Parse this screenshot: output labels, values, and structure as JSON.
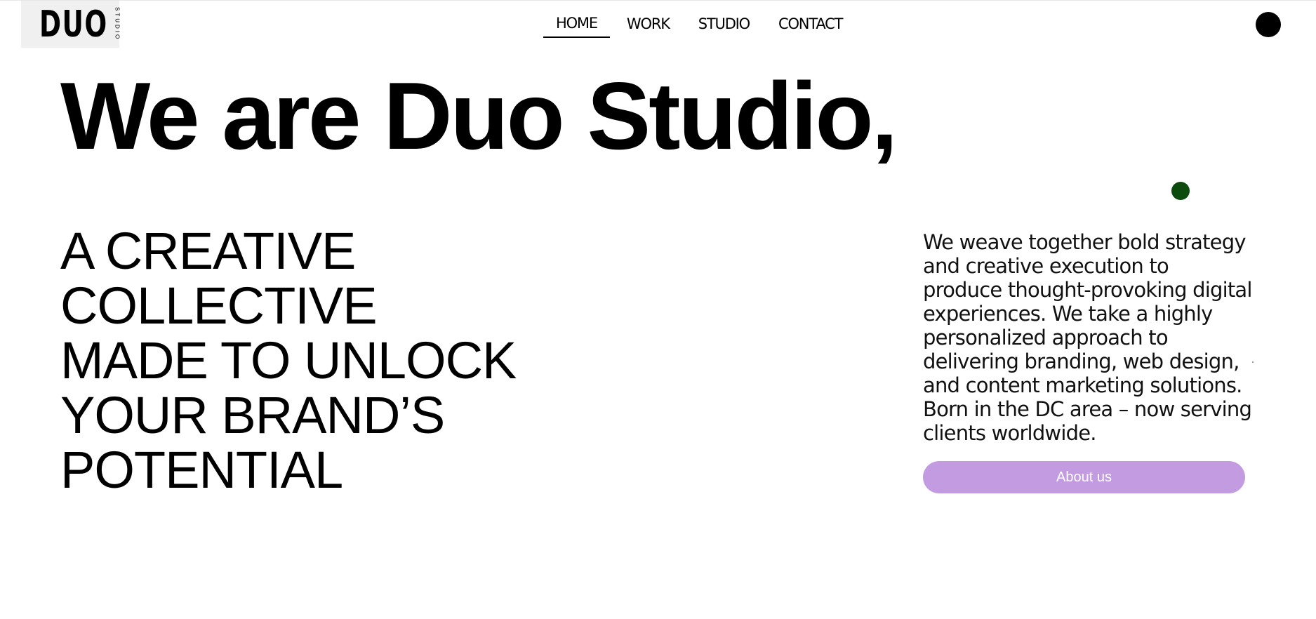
{
  "logo": {
    "main": "DUO",
    "side": "STUDIO"
  },
  "nav": {
    "items": [
      {
        "label": "HOME"
      },
      {
        "label": "WORK"
      },
      {
        "label": "STUDIO"
      },
      {
        "label": "CONTACT"
      }
    ],
    "active": "HOME"
  },
  "hero": {
    "headline": "We are Duo Studio,",
    "tagline": [
      "A CREATIVE",
      "COLLECTIVE",
      "MADE TO UNLOCK",
      "YOUR BRAND’S",
      "POTENTIAL"
    ],
    "description": "We weave together bold strategy and creative execution to produce thought-provoking digital experiences. We take a highly personalized approach to delivering branding, web design, and content marketing solutions. Born in the DC area – now serving clients worldwide.",
    "button_label": "About us"
  },
  "colors": {
    "button": "#c39be0",
    "green_dot": "#0d4a0d",
    "avatar": "#000000"
  }
}
